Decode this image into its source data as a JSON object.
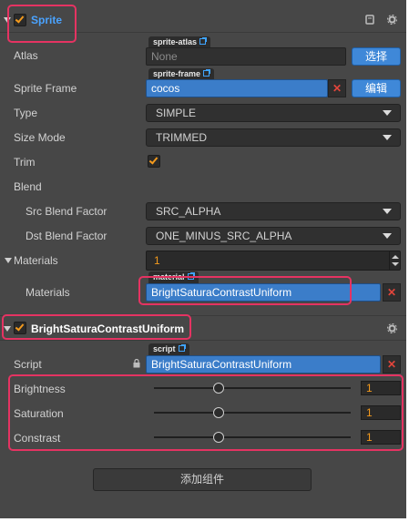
{
  "sprite_component": {
    "title": "Sprite",
    "enabled": true,
    "atlas": {
      "label": "Atlas",
      "tag": "sprite-atlas",
      "value": "None",
      "button": "选择"
    },
    "sprite_frame": {
      "label": "Sprite Frame",
      "tag": "sprite-frame",
      "value": "cocos",
      "button": "编辑"
    },
    "type": {
      "label": "Type",
      "value": "SIMPLE"
    },
    "size_mode": {
      "label": "Size Mode",
      "value": "TRIMMED"
    },
    "trim": {
      "label": "Trim",
      "checked": true
    },
    "blend": {
      "label": "Blend",
      "src": {
        "label": "Src Blend Factor",
        "value": "SRC_ALPHA"
      },
      "dst": {
        "label": "Dst Blend Factor",
        "value": "ONE_MINUS_SRC_ALPHA"
      }
    },
    "materials_array": {
      "label": "Materials",
      "count": "1"
    },
    "materials_item": {
      "label": "Materials",
      "tag": "material",
      "value": "BrightSaturaContrastUniform"
    }
  },
  "custom_component": {
    "title": "BrightSaturaContrastUniform",
    "enabled": true,
    "script": {
      "label": "Script",
      "tag": "script",
      "value": "BrightSaturaContrastUniform"
    },
    "brightness": {
      "label": "Brightness",
      "value": "1",
      "level": 0.33
    },
    "saturation": {
      "label": "Saturation",
      "value": "1",
      "level": 0.33
    },
    "contrast": {
      "label": "Constrast",
      "value": "1",
      "level": 0.33
    }
  },
  "add_component_button": "添加组件",
  "colors": {
    "panel": "#474747",
    "accent": "#3b7dc9",
    "highlight": "#e53362",
    "check": "#f39a1d"
  },
  "icons": [
    "expand-triangle-icon",
    "checkbox-icon",
    "book-icon",
    "gear-icon",
    "link-icon",
    "lock-icon",
    "close-icon",
    "dropdown-arrow-icon",
    "spin-up-icon",
    "spin-down-icon"
  ]
}
